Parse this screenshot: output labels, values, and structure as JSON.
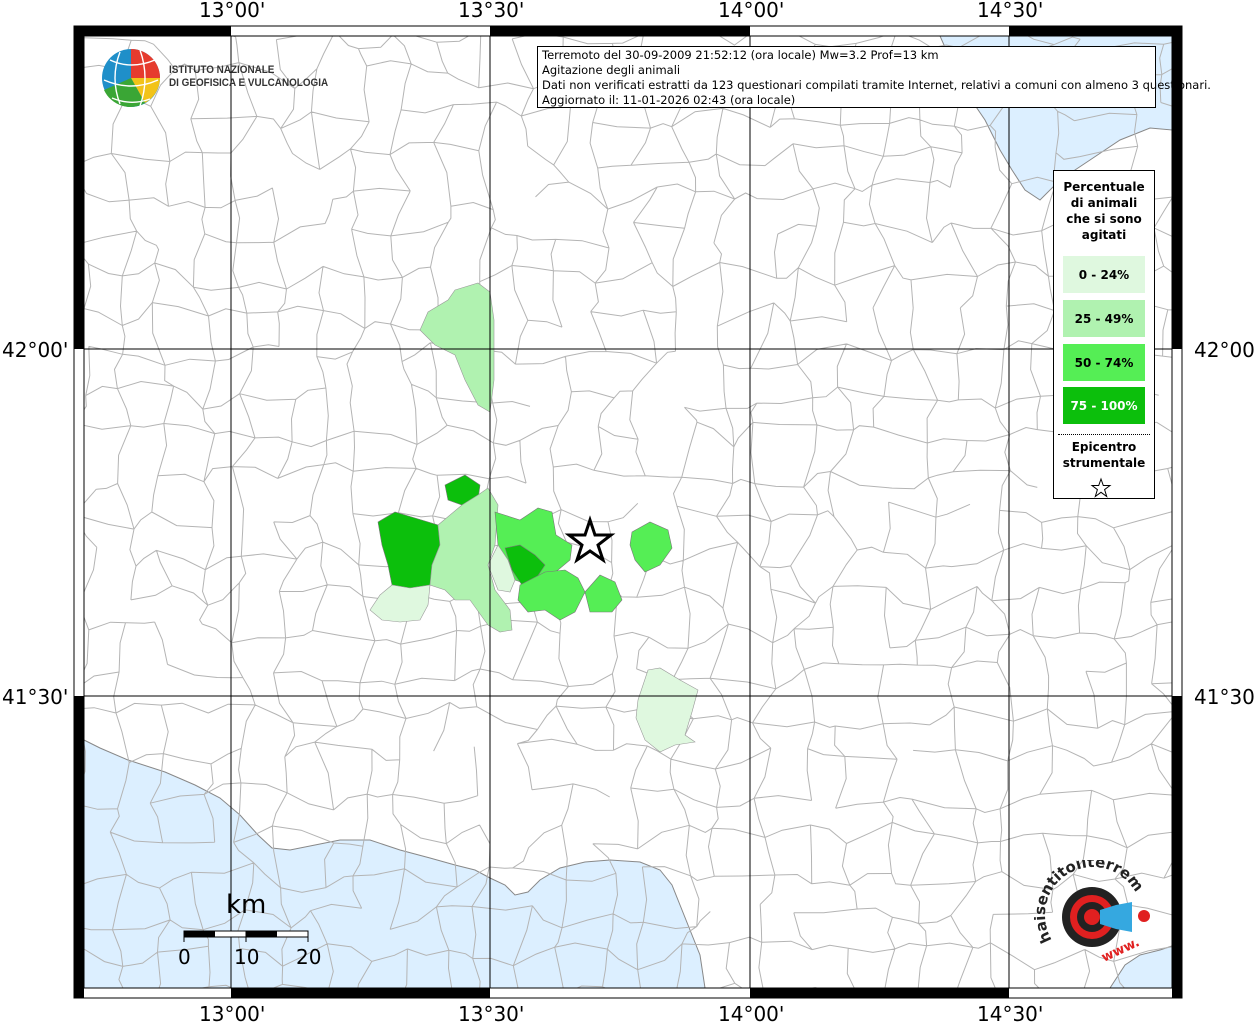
{
  "map": {
    "title_lines": [
      "Terremoto del 30-09-2009 21:52:12 (ora locale) Mw=3.2 Prof=13 km",
      "Agitazione degli animali",
      "Dati non verificati estratti da 123 questionari compilati tramite Internet, relativi a comuni con almeno 3 questionari.",
      "Aggiornato il: 11-01-2026 02:43 (ora locale)"
    ],
    "institute_lines": [
      "ISTITUTO NAZIONALE",
      "DI GEOFISICA E VULCANOLOGIA"
    ],
    "longitude_ticks": [
      "13°00'",
      "13°30'",
      "14°00'",
      "14°30'"
    ],
    "latitude_ticks": [
      "42°00'",
      "41°30'"
    ],
    "colors": {
      "land": "#ffffff",
      "sea": "#dcefff",
      "borders": "#b4b4b4",
      "class_0_24": "#dff8df",
      "class_25_49": "#b0f2b0",
      "class_50_74": "#55ee55",
      "class_75_100": "#0cbf0c"
    }
  },
  "legend": {
    "title": [
      "Percentuale",
      "di animali",
      "che si sono",
      "agitati"
    ],
    "classes": [
      {
        "label": "0 - 24%",
        "color": "#dff8df"
      },
      {
        "label": "25 - 49%",
        "color": "#b0f2b0"
      },
      {
        "label": "50 - 74%",
        "color": "#55ee55"
      },
      {
        "label": "75 - 100%",
        "color": "#0cbf0c"
      }
    ],
    "epicenter_label": [
      "Epicentro",
      "strumentale"
    ],
    "epicenter_icon": "star-icon"
  },
  "scalebar": {
    "unit": "km",
    "labels": [
      "0",
      "10",
      "20"
    ]
  },
  "site_logo": {
    "text": "haisentitoilterremoto.it",
    "url_text": "www.",
    "icon": "speaker-target-icon"
  }
}
